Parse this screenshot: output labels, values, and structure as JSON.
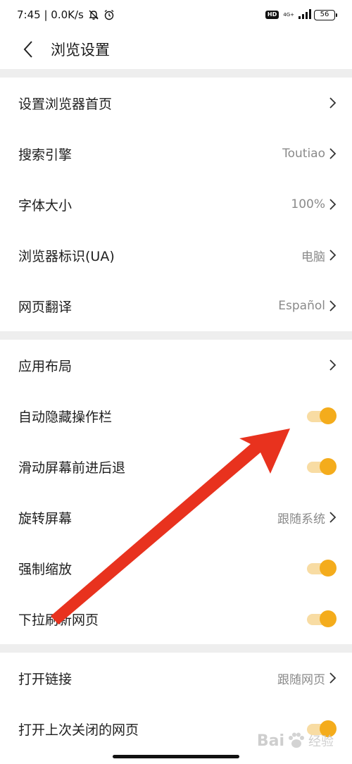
{
  "status_bar": {
    "time_speed": "7:45 | 0.0K/s",
    "hd": "HD",
    "network": "4G+",
    "battery": "56"
  },
  "header": {
    "title": "浏览设置"
  },
  "groups": [
    {
      "rows": [
        {
          "label": "设置浏览器首页",
          "value": "",
          "control": "chevron"
        },
        {
          "label": "搜索引擎",
          "value": "Toutiao",
          "control": "chevron"
        },
        {
          "label": "字体大小",
          "value": "100%",
          "control": "chevron"
        },
        {
          "label": "浏览器标识(UA)",
          "value": "电脑",
          "control": "chevron"
        },
        {
          "label": "网页翻译",
          "value": "Español",
          "control": "chevron"
        }
      ]
    },
    {
      "rows": [
        {
          "label": "应用布局",
          "value": "",
          "control": "chevron"
        },
        {
          "label": "自动隐藏操作栏",
          "value": "",
          "control": "toggle",
          "on": true
        },
        {
          "label": "滑动屏幕前进后退",
          "value": "",
          "control": "toggle",
          "on": true
        },
        {
          "label": "旋转屏幕",
          "value": "跟随系统",
          "control": "chevron"
        },
        {
          "label": "强制缩放",
          "value": "",
          "control": "toggle",
          "on": true
        },
        {
          "label": "下拉刷新网页",
          "value": "",
          "control": "toggle",
          "on": true
        }
      ]
    },
    {
      "rows": [
        {
          "label": "打开链接",
          "value": "跟随网页",
          "control": "chevron"
        },
        {
          "label": "打开上次关闭的网页",
          "value": "",
          "control": "toggle",
          "on": true
        }
      ]
    }
  ],
  "watermark": {
    "text": "Bai",
    "sub": "经验"
  },
  "colors": {
    "toggle_knob": "#f4ac1c",
    "toggle_track": "#f8dca3",
    "annotation_arrow": "#e8321e",
    "separator": "#eeeeee"
  }
}
